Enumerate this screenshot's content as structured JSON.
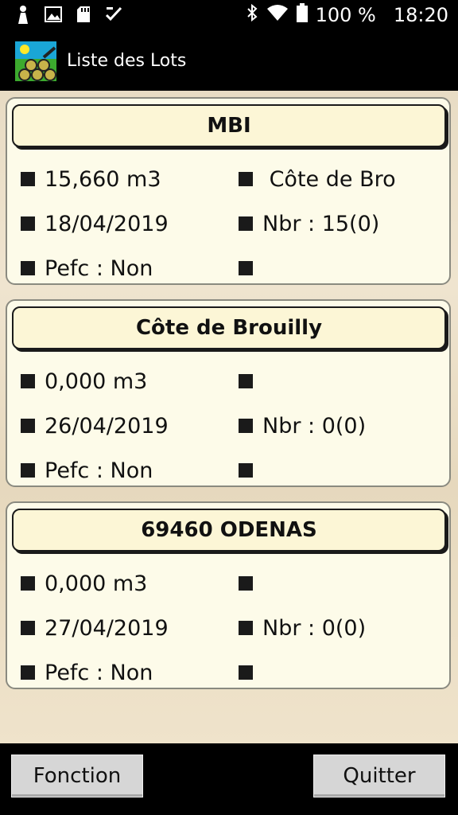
{
  "status_bar": {
    "battery_text": "100 %",
    "time": "18:20",
    "icons": [
      "person-notification-icon",
      "image-icon",
      "sd-card-icon",
      "task-check-icon",
      "bluetooth-icon",
      "wifi-icon",
      "battery-icon"
    ]
  },
  "app": {
    "title": "Liste des Lots",
    "icon": "logs-pile-app-icon"
  },
  "lots": [
    {
      "title": "MBI",
      "volume": "15,660 m3",
      "place": " Côte de Bro",
      "date": "18/04/2019",
      "count": "Nbr : 15(0)",
      "pefc": "Pefc : Non",
      "extra": ""
    },
    {
      "title": "Côte de Brouilly",
      "volume": "0,000 m3",
      "place": "",
      "date": "26/04/2019",
      "count": "Nbr : 0(0)",
      "pefc": "Pefc : Non",
      "extra": ""
    },
    {
      "title": "69460 ODENAS",
      "volume": "0,000 m3",
      "place": "",
      "date": "27/04/2019",
      "count": "Nbr : 0(0)",
      "pefc": "Pefc : Non",
      "extra": ""
    }
  ],
  "buttons": {
    "function_label": "Fonction",
    "quit_label": "Quitter"
  }
}
